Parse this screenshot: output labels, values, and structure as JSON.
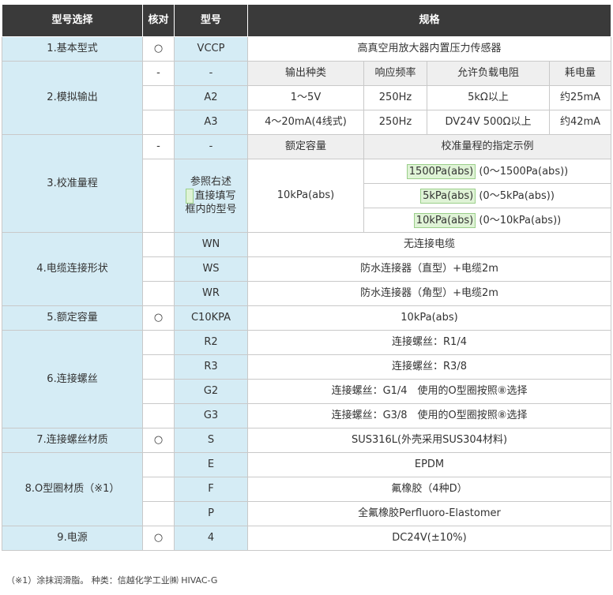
{
  "header": {
    "col1": "型号选择",
    "col2": "核对",
    "col3": "型号",
    "col4": "规格"
  },
  "basic": {
    "label": "1.基本型式",
    "check": "○",
    "code": "VCCP",
    "spec": "高真空用放大器内置压力传感器"
  },
  "analog": {
    "label": "2.模拟输出",
    "dash1": "-",
    "dash2": "-",
    "headers": [
      "输出种类",
      "响应频率",
      "允许负载电阻",
      "耗电量"
    ],
    "rows": [
      {
        "code": "A2",
        "output": "1～5V",
        "freq": "250Hz",
        "load": "5kΩ以上",
        "power": "约25mA"
      },
      {
        "code": "A3",
        "output": "4～20mA(4线式)",
        "freq": "250Hz",
        "load": "DV24V 500Ω以上",
        "power": "约42mA"
      }
    ]
  },
  "range": {
    "label": "3.校准量程",
    "dash1": "-",
    "dash2": "-",
    "header_capacity": "额定容量",
    "header_example": "校准量程的指定示例",
    "ref_line1": "参照右述",
    "ref_line2": "直接填写",
    "ref_line3": "框内的型号",
    "capacity": "10kPa(abs)",
    "examples": [
      {
        "code": "1500Pa(abs)",
        "desc": "(0～1500Pa(abs))"
      },
      {
        "code": "5kPa(abs)",
        "desc": "(0～5kPa(abs))"
      },
      {
        "code": "10kPa(abs)",
        "desc": "(0～10kPa(abs))"
      }
    ]
  },
  "cable": {
    "label": "4.电缆连接形状",
    "rows": [
      {
        "code": "WN",
        "spec": "无连接电缆"
      },
      {
        "code": "WS",
        "spec": "防水连接器（直型）+电缆2m"
      },
      {
        "code": "WR",
        "spec": "防水连接器（角型）+电缆2m"
      }
    ]
  },
  "rated": {
    "label": "5.额定容量",
    "check": "○",
    "code": "C10KPA",
    "spec": "10kPa(abs)"
  },
  "thread": {
    "label": "6.连接螺丝",
    "rows": [
      {
        "code": "R2",
        "spec": "连接螺丝：R1/4"
      },
      {
        "code": "R3",
        "spec": "连接螺丝：R3/8"
      },
      {
        "code": "G2",
        "spec": "连接螺丝：G1/4　使用的O型圈按照⑧选择"
      },
      {
        "code": "G3",
        "spec": "连接螺丝：G3/8　使用的O型圈按照⑧选择"
      }
    ]
  },
  "material": {
    "label": "7.连接螺丝材质",
    "check": "○",
    "code": "S",
    "spec": "SUS316L(外壳采用SUS304材料)"
  },
  "oring": {
    "label": "8.O型圈材质（※1）",
    "rows": [
      {
        "code": "E",
        "spec": "EPDM"
      },
      {
        "code": "F",
        "spec": "氟橡胶（4种D）"
      },
      {
        "code": "P",
        "spec": "全氟橡胶Perfluoro-Elastomer"
      }
    ]
  },
  "power": {
    "label": "9.电源",
    "check": "○",
    "code": "4",
    "spec": "DC24V(±10%)"
  },
  "footnote": "（※1）涂抹润滑脂。 种类：信越化学工业㈱ HIVAC-G",
  "colors": {
    "header_bg": "#3a3a3a",
    "label_bg": "#d5ecf5",
    "sub_header_bg": "#efefef",
    "highlight_bg": "#dff3d6"
  }
}
